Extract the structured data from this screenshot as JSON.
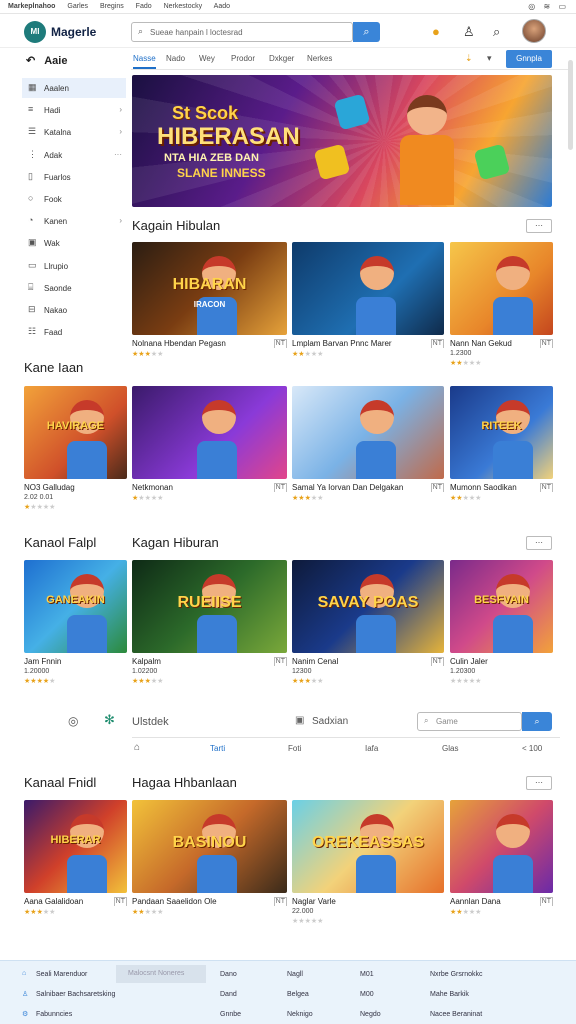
{
  "topbar": {
    "items": [
      "Markeplnahoo",
      "Garles",
      "Bregins",
      "Fado",
      "Nerkestocky",
      "Aado"
    ],
    "icons": [
      "globe-icon",
      "wifi-icon",
      "battery-icon"
    ]
  },
  "header": {
    "logo": "MI",
    "brand": "Magerle",
    "search_placeholder": "Sueae hanpain l loctesrad",
    "search_icon": "search-icon"
  },
  "nav": {
    "tabs": [
      "Nasse",
      "Nado",
      "Wey",
      "Prodor",
      "Dxkger",
      "Nerkes"
    ],
    "active": 0,
    "button": "Gnnpla"
  },
  "sidebar": {
    "heading": "Aaie",
    "items": [
      {
        "label": "Aaalen",
        "icon": "grid-icon",
        "chevron": ""
      },
      {
        "label": "Hadi",
        "icon": "bars-icon",
        "chevron": "›"
      },
      {
        "label": "Katalna",
        "icon": "layers-icon",
        "chevron": "›"
      },
      {
        "label": "Adak",
        "icon": "list-icon",
        "chevron": "···"
      },
      {
        "label": "Fuarlos",
        "icon": "file-icon",
        "chevron": ""
      },
      {
        "label": "Fook",
        "icon": "circle-icon",
        "chevron": ""
      },
      {
        "label": "Kanen",
        "icon": "clock-icon",
        "chevron": "›"
      },
      {
        "label": "Wak",
        "icon": "image-icon",
        "chevron": ""
      },
      {
        "label": "Llrupio",
        "icon": "doc-icon",
        "chevron": ""
      },
      {
        "label": "Saonde",
        "icon": "folder-icon",
        "chevron": ""
      },
      {
        "label": "Nakao",
        "icon": "tag-icon",
        "chevron": ""
      },
      {
        "label": "Faad",
        "icon": "feed-icon",
        "chevron": ""
      }
    ]
  },
  "hero": {
    "line1": "St Scok",
    "line2": "HIBERASAN",
    "line3": "NTA HIA ZEB DAN",
    "line4": "SLANE INNESS"
  },
  "sections": [
    {
      "left_title": "",
      "title": "Kagain Hibulan",
      "more": "⋯",
      "cards": [
        {
          "label": "HIBARAN",
          "sublabel": "IRACON",
          "title": "Nolnana Hbendan Pegasn",
          "badge": "NT",
          "sub": "",
          "stars": 3
        },
        {
          "label": "",
          "sublabel": "",
          "title": "Lmplam Barvan Pnnc Marer",
          "badge": "NT",
          "sub": "",
          "stars": 2
        },
        {
          "label": "",
          "sublabel": "",
          "title": "Nann Nan Gekud",
          "badge": "NT",
          "sub": "1.2300",
          "stars": 2
        }
      ]
    },
    {
      "left_title": "Kane Iaan",
      "title": "",
      "more": "",
      "cards": [
        {
          "label": "HAVIRAGE",
          "sublabel": "",
          "title": "NO3 Galludag",
          "badge": "",
          "sub": "2.02 0.01",
          "stars": 1
        },
        {
          "label": "",
          "sublabel": "",
          "title": "Netkmonan",
          "badge": "NT",
          "sub": "",
          "stars": 1
        },
        {
          "label": "",
          "sublabel": "",
          "title": "Samal Ya Iorvan Dan Delgakan",
          "badge": "NT",
          "sub": "",
          "stars": 3
        },
        {
          "label": "RITEEK",
          "sublabel": "",
          "title": "Mumonn Saodikan",
          "badge": "NT",
          "sub": "",
          "stars": 2
        }
      ]
    },
    {
      "left_title": "Kanaol Falpl",
      "title": "Kagan Hiburan",
      "more": "⋯",
      "cards": [
        {
          "label": "GANEAKIN",
          "sublabel": "",
          "title": "Jam Fnnin",
          "badge": "",
          "sub": "1.20000",
          "stars": 4
        },
        {
          "label": "RUEIISE",
          "sublabel": "",
          "title": "Kalpalm",
          "badge": "NT",
          "sub": "1.02200",
          "stars": 3
        },
        {
          "label": "SAVAY POAS",
          "sublabel": "",
          "title": "Nanim Cenal",
          "badge": "NT",
          "sub": "12300",
          "stars": 3
        },
        {
          "label": "BESFVAIN",
          "sublabel": "",
          "title": "Culin Jaler",
          "badge": "",
          "sub": "1.20300",
          "stars": 0
        }
      ]
    },
    {
      "left_title": "Kanaal Fnidl",
      "title": "Hagaa Hhbanlaan",
      "more": "⋯",
      "cards": [
        {
          "label": "HIBERAR",
          "sublabel": "",
          "title": "Aana Galalidoan",
          "badge": "NT",
          "sub": "",
          "stars": 3
        },
        {
          "label": "BASINOU",
          "sublabel": "",
          "title": "Pandaan Saaelidon Ole",
          "badge": "NT",
          "sub": "",
          "stars": 2
        },
        {
          "label": "OREKEASSAS",
          "sublabel": "",
          "title": "Naglar Varle",
          "badge": "",
          "sub": "22.000",
          "stars": 0
        },
        {
          "label": "",
          "sublabel": "",
          "title": "Aannlan Dana",
          "badge": "NT",
          "sub": "",
          "stars": 2
        }
      ]
    }
  ],
  "midbar": {
    "left_text": "Ulstdek",
    "right_text": "Sadxian",
    "search_placeholder": "Game",
    "tabs": [
      "Tarti",
      "Foti",
      "Iafa",
      "Glas",
      "< 100"
    ],
    "active": 0
  },
  "footer": {
    "col1": [
      "Seali Marenduor",
      "Salnibaer Bachsaretsking",
      "Fabunncies"
    ],
    "col2": [
      "Malocsnt Noneres",
      "",
      ""
    ],
    "col3": [
      "Dano",
      "Dand",
      "Gnnbe"
    ],
    "col4": [
      "Nagll",
      "Belgea",
      "Neknigo"
    ],
    "col5": [
      "M01",
      "M00",
      "Negdo"
    ],
    "col6": [
      "Nxrbe Grsrnokkc",
      "Mahe Barkik",
      "Nacee Beraninat"
    ]
  },
  "colors": {
    "accent": "#3a85d8",
    "star": "#e8a21a",
    "footer_bg": "#eaf3fb"
  }
}
